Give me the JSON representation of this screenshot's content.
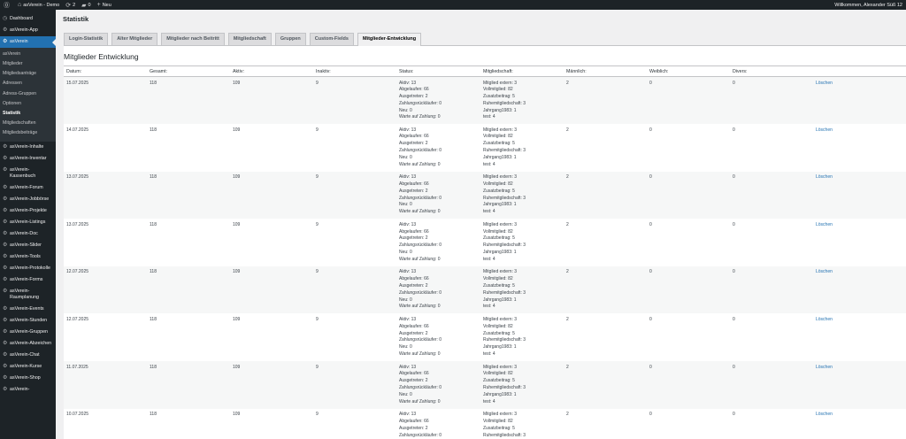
{
  "adminbar": {
    "site_name": "asVerein - Demo",
    "updates_count": "2",
    "comments_count": "0",
    "new_label": "Neu",
    "welcome": "Willkommen, Alexander Süß 12"
  },
  "sidebar": {
    "dashboard": "Dashboard",
    "app": "asVerein-App",
    "current": "asVerein",
    "submenu": [
      "asVerein",
      "Mitglieder",
      "Mitgliedsanträge",
      "Adressen",
      "Adress-Gruppen",
      "Optionen",
      "Statistik",
      "Mitgliedschaften",
      "Mitgliedsbeiträge"
    ],
    "items": [
      "asVerein-Inhalte",
      "asVerein-Inventar",
      "asVerein-Kassenbuch",
      "asVerein-Forum",
      "asVerein-Jobbörse",
      "asVerein-Projekte",
      "asVerein-Listings",
      "asVerein-Doc",
      "asVerein-Slider",
      "asVerein-Tools",
      "asVerein-Protokolle",
      "asVerein-Forms",
      "asVerein-Raumplanung",
      "asVerein-Events",
      "asVerein-Stunden",
      "asVerein-Gruppen",
      "asVerein-Abzeichen",
      "asVerein-Chat",
      "asVerein-Kurse",
      "asVerein-Shop",
      "asVerein-"
    ]
  },
  "page": {
    "title": "Statistik",
    "tabs": [
      "Login-Statistik",
      "Alter Mitglieder",
      "Mitglieder nach Beitritt",
      "Mitgliedschaft",
      "Gruppen",
      "Custom-Fields",
      "Mitglieder-Entwicklung"
    ],
    "active_tab": 6,
    "section_title": "Mitglieder Entwicklung"
  },
  "table": {
    "headers": [
      "Datum:",
      "Gesamt:",
      "Aktiv:",
      "Inaktiv:",
      "Status:",
      "Mitgliedschaft:",
      "Männlich:",
      "Weiblich:",
      "Divers:",
      ""
    ],
    "rows": [
      {
        "date": "15.07.2025",
        "gesamt": "118",
        "aktiv": "109",
        "inaktiv": "9",
        "status": [
          "Aktiv: 13",
          "Abgelaufen: 66",
          "Ausgetreten: 2",
          "Zahlungsrückläufer: 0",
          "Neu: 0",
          "Warte auf Zahlung: 0"
        ],
        "membership": [
          "Mitglied extern: 3",
          "Vollmitglied: 82",
          "Zusatzbeitrag: 5",
          "Ruhemitgliedschaft: 3",
          "Jahrgang1983: 1",
          "test: 4"
        ],
        "male": "2",
        "female": "0",
        "divers": "0",
        "action": "Löschen"
      },
      {
        "date": "14.07.2025",
        "gesamt": "118",
        "aktiv": "109",
        "inaktiv": "9",
        "status": [
          "Aktiv: 13",
          "Abgelaufen: 66",
          "Ausgetreten: 2",
          "Zahlungsrückläufer: 0",
          "Neu: 0",
          "Warte auf Zahlung: 0"
        ],
        "membership": [
          "Mitglied extern: 3",
          "Vollmitglied: 82",
          "Zusatzbeitrag: 5",
          "Ruhemitgliedschaft: 3",
          "Jahrgang1983: 1",
          "test: 4"
        ],
        "male": "2",
        "female": "0",
        "divers": "0",
        "action": "Löschen"
      },
      {
        "date": "13.07.2025",
        "gesamt": "118",
        "aktiv": "109",
        "inaktiv": "9",
        "status": [
          "Aktiv: 13",
          "Abgelaufen: 66",
          "Ausgetreten: 2",
          "Zahlungsrückläufer: 0",
          "Neu: 0",
          "Warte auf Zahlung: 0"
        ],
        "membership": [
          "Mitglied extern: 3",
          "Vollmitglied: 82",
          "Zusatzbeitrag: 5",
          "Ruhemitgliedschaft: 3",
          "Jahrgang1983: 1",
          "test: 4"
        ],
        "male": "2",
        "female": "0",
        "divers": "0",
        "action": "Löschen"
      },
      {
        "date": "13.07.2025",
        "gesamt": "118",
        "aktiv": "109",
        "inaktiv": "9",
        "status": [
          "Aktiv: 13",
          "Abgelaufen: 66",
          "Ausgetreten: 2",
          "Zahlungsrückläufer: 0",
          "Neu: 0",
          "Warte auf Zahlung: 0"
        ],
        "membership": [
          "Mitglied extern: 3",
          "Vollmitglied: 82",
          "Zusatzbeitrag: 5",
          "Ruhemitgliedschaft: 3",
          "Jahrgang1983: 1",
          "test: 4"
        ],
        "male": "2",
        "female": "0",
        "divers": "0",
        "action": "Löschen"
      },
      {
        "date": "12.07.2025",
        "gesamt": "118",
        "aktiv": "109",
        "inaktiv": "9",
        "status": [
          "Aktiv: 13",
          "Abgelaufen: 66",
          "Ausgetreten: 2",
          "Zahlungsrückläufer: 0",
          "Neu: 0",
          "Warte auf Zahlung: 0"
        ],
        "membership": [
          "Mitglied extern: 3",
          "Vollmitglied: 82",
          "Zusatzbeitrag: 5",
          "Ruhemitgliedschaft: 3",
          "Jahrgang1983: 1",
          "test: 4"
        ],
        "male": "2",
        "female": "0",
        "divers": "0",
        "action": "Löschen"
      },
      {
        "date": "12.07.2025",
        "gesamt": "118",
        "aktiv": "109",
        "inaktiv": "9",
        "status": [
          "Aktiv: 13",
          "Abgelaufen: 66",
          "Ausgetreten: 2",
          "Zahlungsrückläufer: 0",
          "Neu: 0",
          "Warte auf Zahlung: 0"
        ],
        "membership": [
          "Mitglied extern: 3",
          "Vollmitglied: 82",
          "Zusatzbeitrag: 5",
          "Ruhemitgliedschaft: 3",
          "Jahrgang1983: 1",
          "test: 4"
        ],
        "male": "2",
        "female": "0",
        "divers": "0",
        "action": "Löschen"
      },
      {
        "date": "11.07.2025",
        "gesamt": "118",
        "aktiv": "109",
        "inaktiv": "9",
        "status": [
          "Aktiv: 13",
          "Abgelaufen: 66",
          "Ausgetreten: 2",
          "Zahlungsrückläufer: 0",
          "Neu: 0",
          "Warte auf Zahlung: 0"
        ],
        "membership": [
          "Mitglied extern: 3",
          "Vollmitglied: 82",
          "Zusatzbeitrag: 5",
          "Ruhemitgliedschaft: 3",
          "Jahrgang1983: 1",
          "test: 4"
        ],
        "male": "2",
        "female": "0",
        "divers": "0",
        "action": "Löschen"
      },
      {
        "date": "10.07.2025",
        "gesamt": "118",
        "aktiv": "109",
        "inaktiv": "9",
        "status": [
          "Aktiv: 13",
          "Abgelaufen: 66",
          "Ausgetreten: 2",
          "Zahlungsrückläufer: 0"
        ],
        "membership": [
          "Mitglied extern: 3",
          "Vollmitglied: 82",
          "Zusatzbeitrag: 5",
          "Ruhemitgliedschaft: 3"
        ],
        "male": "2",
        "female": "0",
        "divers": "0",
        "action": "Löschen"
      }
    ]
  }
}
